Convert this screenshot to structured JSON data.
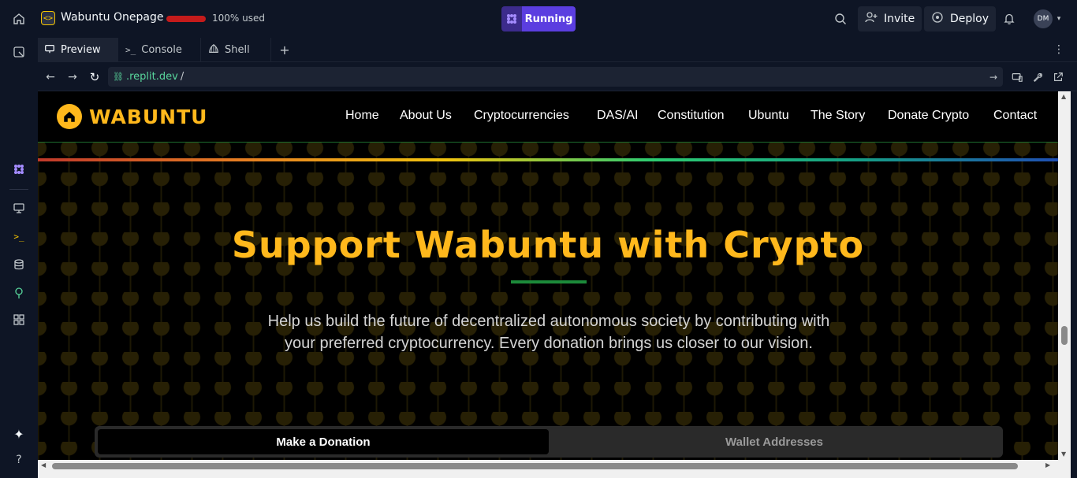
{
  "topbar": {
    "repl_name": "Wabuntu Onepage",
    "usage_fraction": 1.0,
    "usage_text": "100% used",
    "run_label": "Running",
    "invite_label": "Invite",
    "deploy_label": "Deploy",
    "avatar_initials": "DM"
  },
  "tabs": [
    {
      "label": "Preview",
      "icon": "monitor-icon"
    },
    {
      "label": "Console",
      "icon": "terminal-icon"
    },
    {
      "label": "Shell",
      "icon": "shell-icon"
    }
  ],
  "url": {
    "host": ".replit.dev",
    "path": "/"
  },
  "site": {
    "logo_text": "WABUNTU",
    "nav": [
      "Home",
      "About Us",
      "Cryptocurrencies",
      "DAS/AI",
      "Constitution",
      "Ubuntu",
      "The Story",
      "Donate Crypto",
      "Contact"
    ],
    "hero_title": "Support Wabuntu with Crypto",
    "hero_sub": "Help us build the future of decentralized autonomous society by contributing with your preferred cryptocurrency. Every donation brings us closer to our vision.",
    "tab_donation": "Make a Donation",
    "tab_wallets": "Wallet Addresses"
  },
  "colors": {
    "accent": "#ffb81c",
    "run": "#5b3ee0",
    "green_rule": "#1c8a3a",
    "usage": "#c41b1b"
  }
}
